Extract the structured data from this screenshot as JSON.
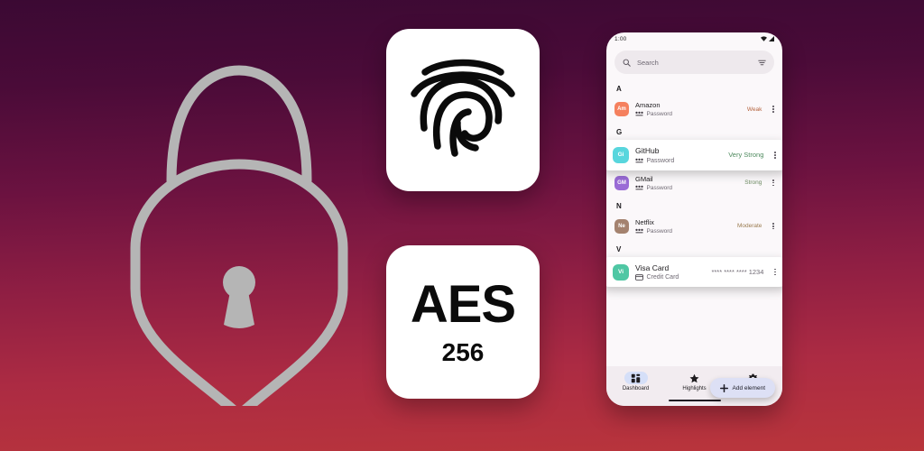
{
  "background": {
    "top_color": "#3B0933",
    "bottom_color": "#B9353B"
  },
  "brand": {
    "logo_name": "lock-shield-logo",
    "logo_color": "#B5B5B5"
  },
  "feature_cards": [
    {
      "id": "fingerprint",
      "icon": "fingerprint-icon",
      "title": "",
      "subtitle": ""
    },
    {
      "id": "aes",
      "icon": "",
      "title": "AES",
      "subtitle": "256"
    }
  ],
  "phone": {
    "status_bar": {
      "time": "1:00",
      "icons": [
        "wifi-icon",
        "signal-icon"
      ]
    },
    "search": {
      "placeholder": "Search",
      "search_icon": "search-icon",
      "filter_icon": "tune-filter-icon"
    },
    "sections": [
      {
        "letter": "A",
        "entries": [
          {
            "avatar_initials": "Am",
            "avatar_color": "#F5805E",
            "title": "Amazon",
            "type_icon": "password-dots-icon",
            "type": "Password",
            "meta": "Weak",
            "meta_color": "#B4633D",
            "elevated": false
          }
        ]
      },
      {
        "letter": "G",
        "entries": [
          {
            "avatar_initials": "Gi",
            "avatar_color": "#58D6DD",
            "title": "GitHub",
            "type_icon": "password-dots-icon",
            "type": "Password",
            "meta": "Very Strong",
            "meta_color": "#4E8A5E",
            "elevated": true
          },
          {
            "avatar_initials": "GM",
            "avatar_color": "#9A6BD6",
            "title": "GMail",
            "type_icon": "password-dots-icon",
            "type": "Password",
            "meta": "Strong",
            "meta_color": "#6D8B62",
            "elevated": false
          }
        ]
      },
      {
        "letter": "N",
        "entries": [
          {
            "avatar_initials": "Ne",
            "avatar_color": "#A4826F",
            "title": "Netflix",
            "type_icon": "password-dots-icon",
            "type": "Password",
            "meta": "Moderate",
            "meta_color": "#9A7B4F",
            "elevated": false
          }
        ]
      },
      {
        "letter": "V",
        "entries": [
          {
            "avatar_initials": "Vi",
            "avatar_color": "#4FC7A4",
            "title": "Visa Card",
            "type_icon": "credit-card-icon",
            "type": "Credit Card",
            "meta": "**** **** **** 1234",
            "meta_color": "#6E6872",
            "elevated": true
          }
        ]
      }
    ],
    "fab": {
      "label": "Add element",
      "icon": "plus-icon",
      "color": "#DDE0F5"
    },
    "bottom_nav": {
      "items": [
        {
          "label": "Dashboard",
          "icon": "dashboard-grid-icon",
          "active": true
        },
        {
          "label": "Highlights",
          "icon": "star-icon",
          "active": false
        },
        {
          "label": "Settings",
          "icon": "gear-icon",
          "active": false
        }
      ]
    }
  }
}
